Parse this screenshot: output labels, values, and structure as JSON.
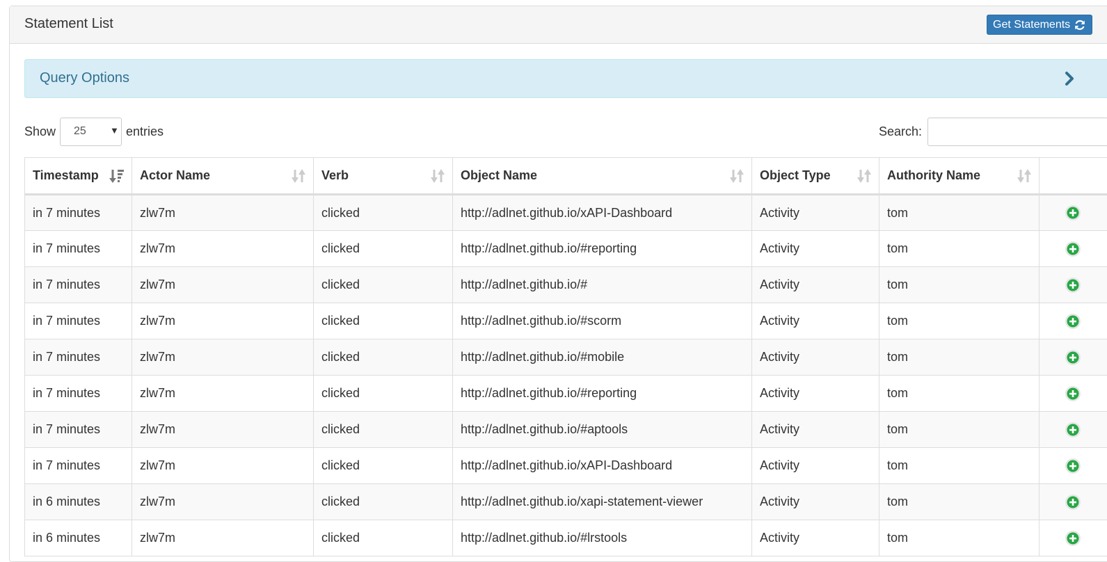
{
  "panel": {
    "title": "Statement List",
    "get_button_label": "Get Statements"
  },
  "query": {
    "title": "Query Options"
  },
  "length": {
    "show_label": "Show",
    "value": "25",
    "entries_label": "entries"
  },
  "search": {
    "label": "Search:",
    "value": ""
  },
  "table": {
    "columns": [
      "Timestamp",
      "Actor Name",
      "Verb",
      "Object Name",
      "Object Type",
      "Authority Name",
      ""
    ],
    "rows": [
      [
        "in 7 minutes",
        "zlw7m",
        "clicked",
        "http://adlnet.github.io/xAPI-Dashboard",
        "Activity",
        "tom"
      ],
      [
        "in 7 minutes",
        "zlw7m",
        "clicked",
        "http://adlnet.github.io/#reporting",
        "Activity",
        "tom"
      ],
      [
        "in 7 minutes",
        "zlw7m",
        "clicked",
        "http://adlnet.github.io/#",
        "Activity",
        "tom"
      ],
      [
        "in 7 minutes",
        "zlw7m",
        "clicked",
        "http://adlnet.github.io/#scorm",
        "Activity",
        "tom"
      ],
      [
        "in 7 minutes",
        "zlw7m",
        "clicked",
        "http://adlnet.github.io/#mobile",
        "Activity",
        "tom"
      ],
      [
        "in 7 minutes",
        "zlw7m",
        "clicked",
        "http://adlnet.github.io/#reporting",
        "Activity",
        "tom"
      ],
      [
        "in 7 minutes",
        "zlw7m",
        "clicked",
        "http://adlnet.github.io/#aptools",
        "Activity",
        "tom"
      ],
      [
        "in 7 minutes",
        "zlw7m",
        "clicked",
        "http://adlnet.github.io/xAPI-Dashboard",
        "Activity",
        "tom"
      ],
      [
        "in 6 minutes",
        "zlw7m",
        "clicked",
        "http://adlnet.github.io/xapi-statement-viewer",
        "Activity",
        "tom"
      ],
      [
        "in 6 minutes",
        "zlw7m",
        "clicked",
        "http://adlnet.github.io/#lrstools",
        "Activity",
        "tom"
      ]
    ]
  },
  "icons": {
    "refresh": "refresh-icon",
    "chevron": "chevron-right-icon",
    "sort_desc": "sort-desc-icon",
    "sort": "sort-icon",
    "details": "plus-circle-icon"
  },
  "colors": {
    "primary": "#337ab7",
    "info_bg": "#d9edf7",
    "info_text": "#31708f",
    "plus": "#28a745"
  }
}
